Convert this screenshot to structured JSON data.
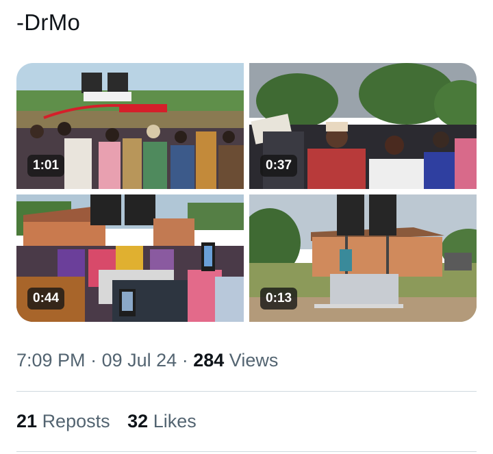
{
  "post": {
    "signature": "-DrMo",
    "time": "7:09 PM",
    "date": "09 Jul 24",
    "separator": "·",
    "views_count": "284",
    "views_label": "Views"
  },
  "media": [
    {
      "duration": "1:01"
    },
    {
      "duration": "0:37"
    },
    {
      "duration": "0:44"
    },
    {
      "duration": "0:13"
    }
  ],
  "stats": {
    "reposts_count": "21",
    "reposts_label": "Reposts",
    "likes_count": "32",
    "likes_label": "Likes"
  }
}
